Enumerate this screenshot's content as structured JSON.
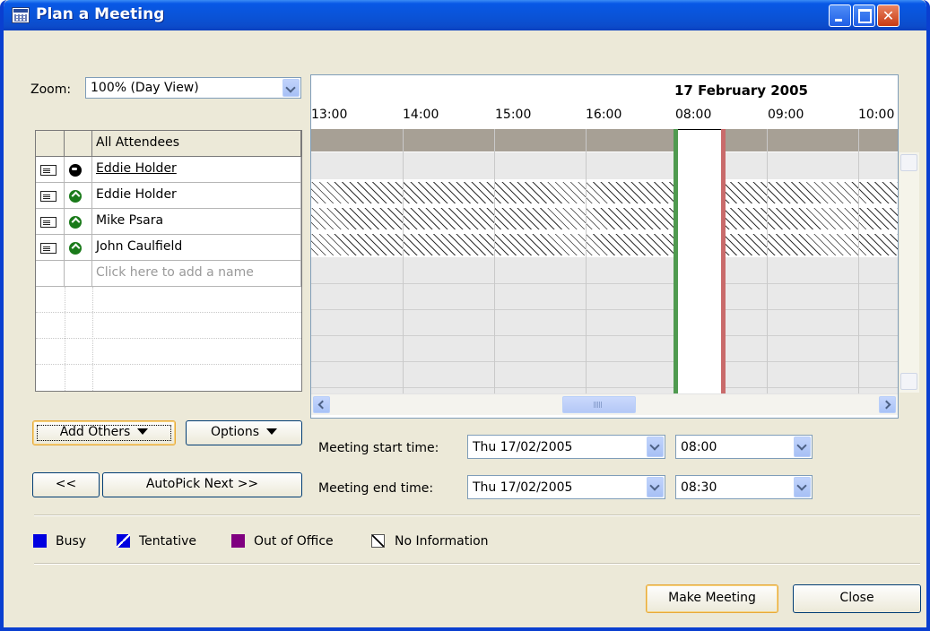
{
  "window": {
    "title": "Plan a Meeting"
  },
  "zoom": {
    "label": "Zoom:",
    "value": "100% (Day View)"
  },
  "schedule": {
    "date": "17 February 2005",
    "hours": [
      "13:00",
      "14:00",
      "15:00",
      "16:00",
      "08:00",
      "09:00",
      "10:00"
    ]
  },
  "attendees": {
    "header": "All Attendees",
    "items": [
      {
        "name": "Eddie Holder",
        "status": "organizer"
      },
      {
        "name": "Eddie Holder",
        "status": "required"
      },
      {
        "name": "Mike Psara",
        "status": "required"
      },
      {
        "name": "John Caulfield",
        "status": "required"
      }
    ],
    "add_placeholder": "Click here to add a name"
  },
  "buttons": {
    "add_others": "Add Others",
    "options": "Options",
    "prev": "<<",
    "autopick": "AutoPick Next >>",
    "make_meeting": "Make Meeting",
    "close": "Close"
  },
  "meeting_start": {
    "label": "Meeting start time:",
    "date": "Thu 17/02/2005",
    "time": "08:00"
  },
  "meeting_end": {
    "label": "Meeting end time:",
    "date": "Thu 17/02/2005",
    "time": "08:30"
  },
  "legend": [
    {
      "label": "Busy",
      "color": "#0000e0"
    },
    {
      "label": "Tentative",
      "color": "#0000e0"
    },
    {
      "label": "Out of Office",
      "color": "#800080"
    },
    {
      "label": "No Information",
      "color": "#ffffff"
    }
  ]
}
